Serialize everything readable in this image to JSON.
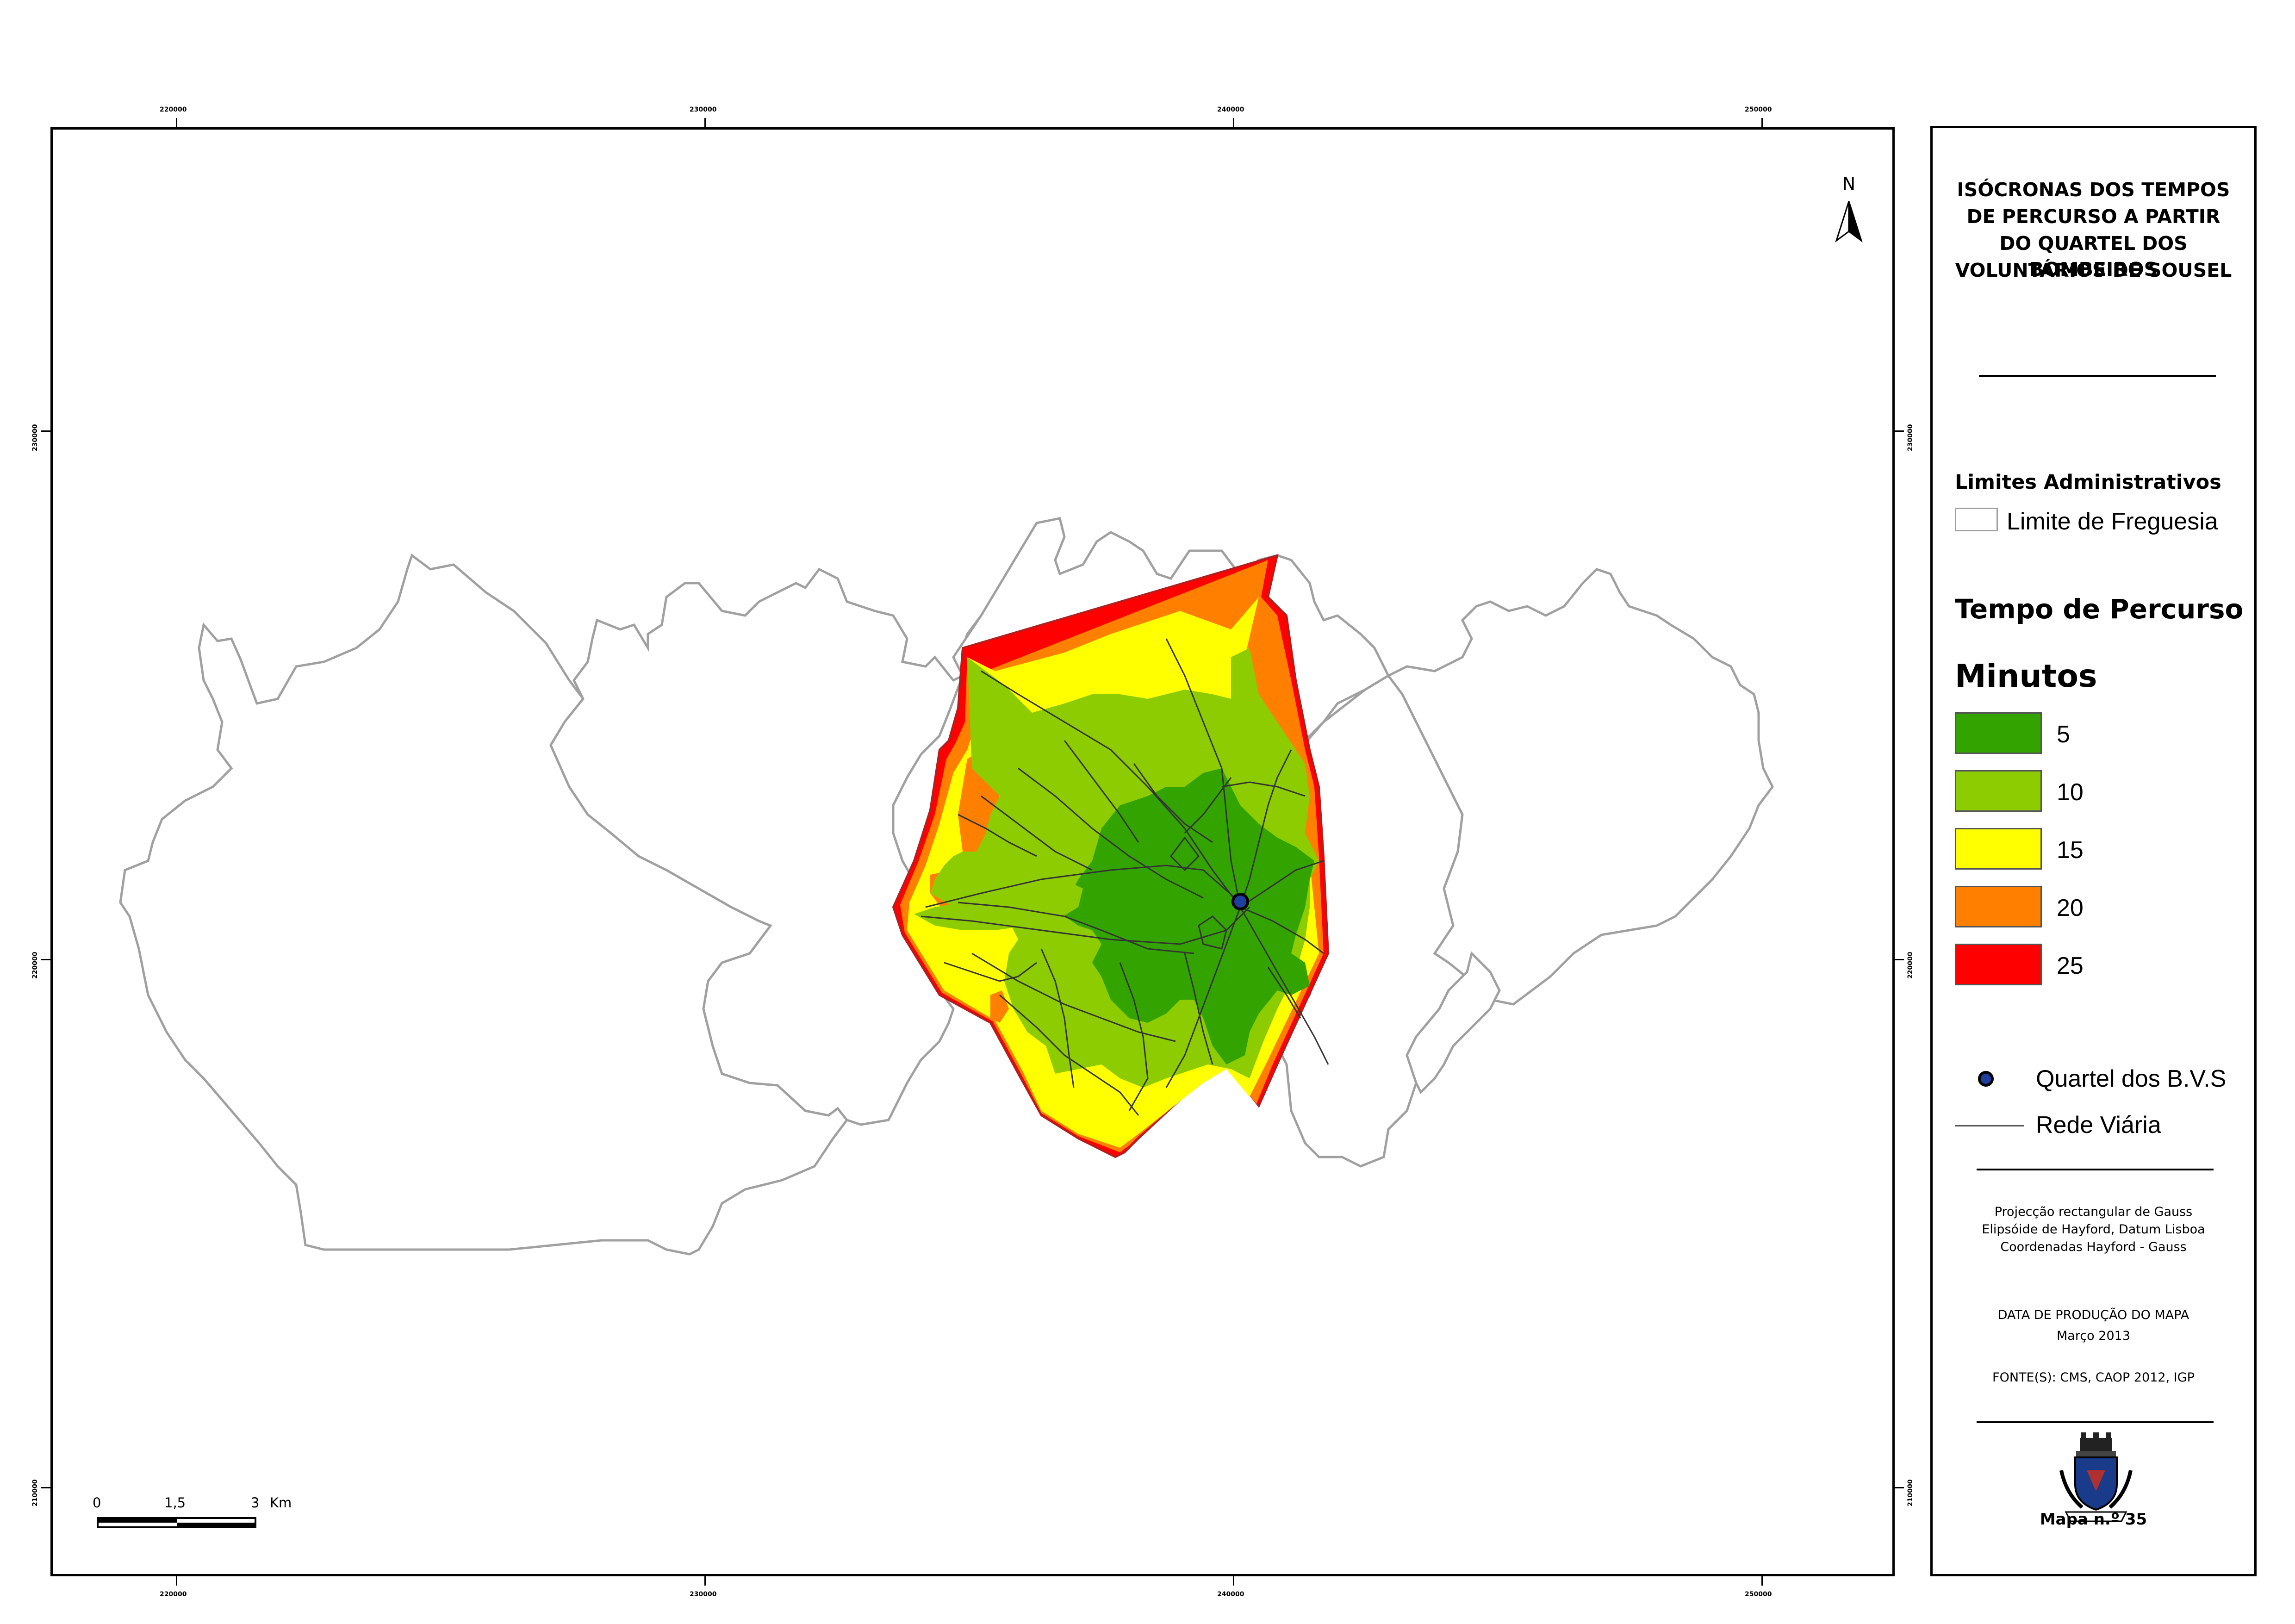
{
  "title_lines": [
    "ISÓCRONAS DOS TEMPOS",
    "DE PERCURSO A PARTIR",
    "DO QUARTEL DOS BOMBEIROS",
    "VOLUNTÁRIOS DE SOUSEL"
  ],
  "north_label": "N",
  "grid": {
    "x_labels": [
      "220000",
      "230000",
      "240000",
      "250000"
    ],
    "y_labels": [
      "230000",
      "220000",
      "210000"
    ]
  },
  "legend": {
    "admin_heading": "Limites Administrativos",
    "admin_item": "Limite de Freguesia",
    "time_heading": "Tempo de Percurso",
    "minutes_heading": "Minutos",
    "classes": [
      {
        "label": "5",
        "color": "#33a300"
      },
      {
        "label": "10",
        "color": "#8ccc00"
      },
      {
        "label": "15",
        "color": "#ffff00"
      },
      {
        "label": "20",
        "color": "#ff7f00"
      },
      {
        "label": "25",
        "color": "#ff0000"
      }
    ],
    "station": "Quartel dos B.V.S",
    "roads": "Rede Viária"
  },
  "projection_lines": [
    "Projecção rectangular de Gauss",
    "Elipsóide de Hayford, Datum Lisboa",
    "Coordenadas Hayford - Gauss"
  ],
  "production": {
    "label": "DATA DE PRODUÇÃO DO MAPA",
    "date": "Março 2013"
  },
  "sources": "FONTE(S): CMS, CAOP 2012, IGP",
  "map_number": "Mapa n.º 35",
  "scale_bar": {
    "labels": [
      "0",
      "1,5",
      "3"
    ],
    "unit": "Km"
  },
  "colors": {
    "boundary": "#a0a0a0",
    "road": "#333333",
    "station_fill": "#1f3f9f"
  }
}
